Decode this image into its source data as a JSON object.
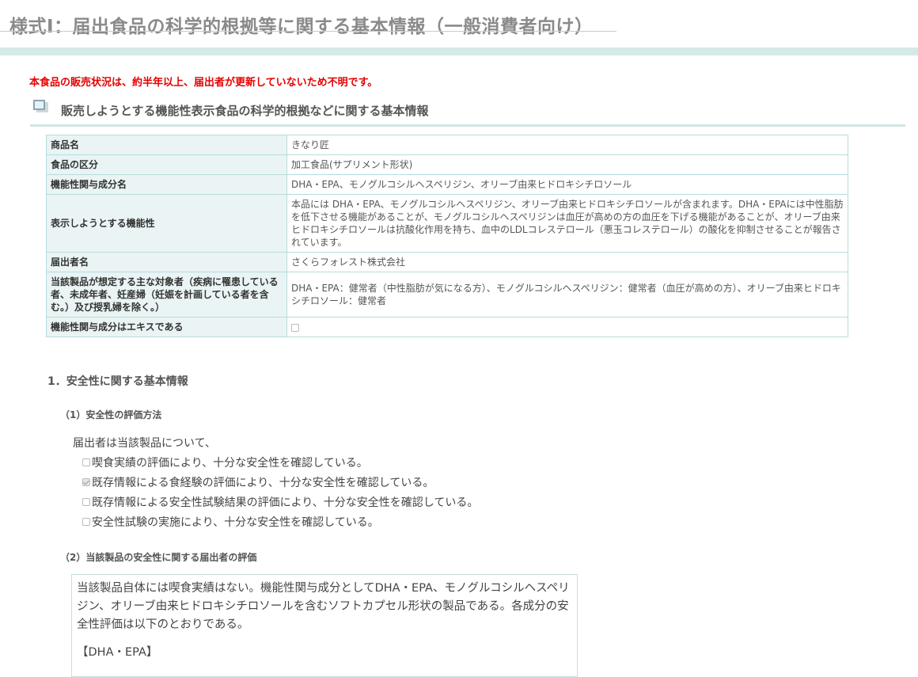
{
  "page": {
    "title": "様式Ⅰ：届出食品の科学的根拠等に関する基本情報（一般消費者向け）",
    "notice": "本食品の販売状況は、約半年以上、届出者が更新していないため不明です。",
    "notice_color": "#e60000",
    "accent_color": "#d4e9e8"
  },
  "section": {
    "heading": "販売しようとする機能性表示食品の科学的根拠などに関する基本情報",
    "icon": "document-stack-icon"
  },
  "info_table": {
    "rows": [
      {
        "label": "商品名",
        "value": "きなり匠"
      },
      {
        "label": "食品の区分",
        "value": "加工食品(サプリメント形状)"
      },
      {
        "label": "機能性関与成分名",
        "value": "DHA・EPA、モノグルコシルヘスペリジン、オリーブ由来ヒドロキシチロソール"
      },
      {
        "label": "表示しようとする機能性",
        "value": "本品には DHA・EPA、モノグルコシルヘスペリジン、オリーブ由来ヒドロキシチロソールが含まれます。DHA・EPAには中性脂肪を低下させる機能があることが、モノグルコシルヘスペリジンは血圧が高めの方の血圧を下げる機能があることが、オリーブ由来ヒドロキシチロソールは抗酸化作用を持ち、血中のLDLコレステロール（悪玉コレステロール）の酸化を抑制させることが報告されています。"
      },
      {
        "label": "届出者名",
        "value": "さくらフォレスト株式会社"
      },
      {
        "label": "当該製品が想定する主な対象者（疾病に罹患している者、未成年者、妊産婦（妊娠を計画している者を含む。）及び授乳婦を除く。）",
        "value": "DHA・EPA：健常者（中性脂肪が気になる方）、モノグルコシルヘスペリジン：健常者（血圧が高めの方）、オリーブ由来ヒドロキシチロソール：健常者"
      }
    ],
    "extract_row": {
      "label": "機能性関与成分はエキスである",
      "checked": false
    }
  },
  "safety": {
    "heading": "1．安全性に関する基本情報",
    "method": {
      "heading": "（1）安全性の評価方法",
      "intro": "届出者は当該製品について、",
      "options": [
        {
          "label": "喫食実績の評価により、十分な安全性を確認している。",
          "checked": false
        },
        {
          "label": "既存情報による食経験の評価により、十分な安全性を確認している。",
          "checked": true
        },
        {
          "label": "既存情報による安全性試験結果の評価により、十分な安全性を確認している。",
          "checked": false
        },
        {
          "label": "安全性試験の実施により、十分な安全性を確認している。",
          "checked": false
        }
      ]
    },
    "evaluation": {
      "heading": "（2）当該製品の安全性に関する届出者の評価",
      "text": "当該製品自体には喫食実績はない。機能性関与成分としてDHA・EPA、モノグルコシルヘスペリジン、オリーブ由来ヒドロキシチロソールを含むソフトカプセル形状の製品である。各成分の安全性評価は以下のとおりである。",
      "subheading": "【DHA・EPA】"
    }
  }
}
